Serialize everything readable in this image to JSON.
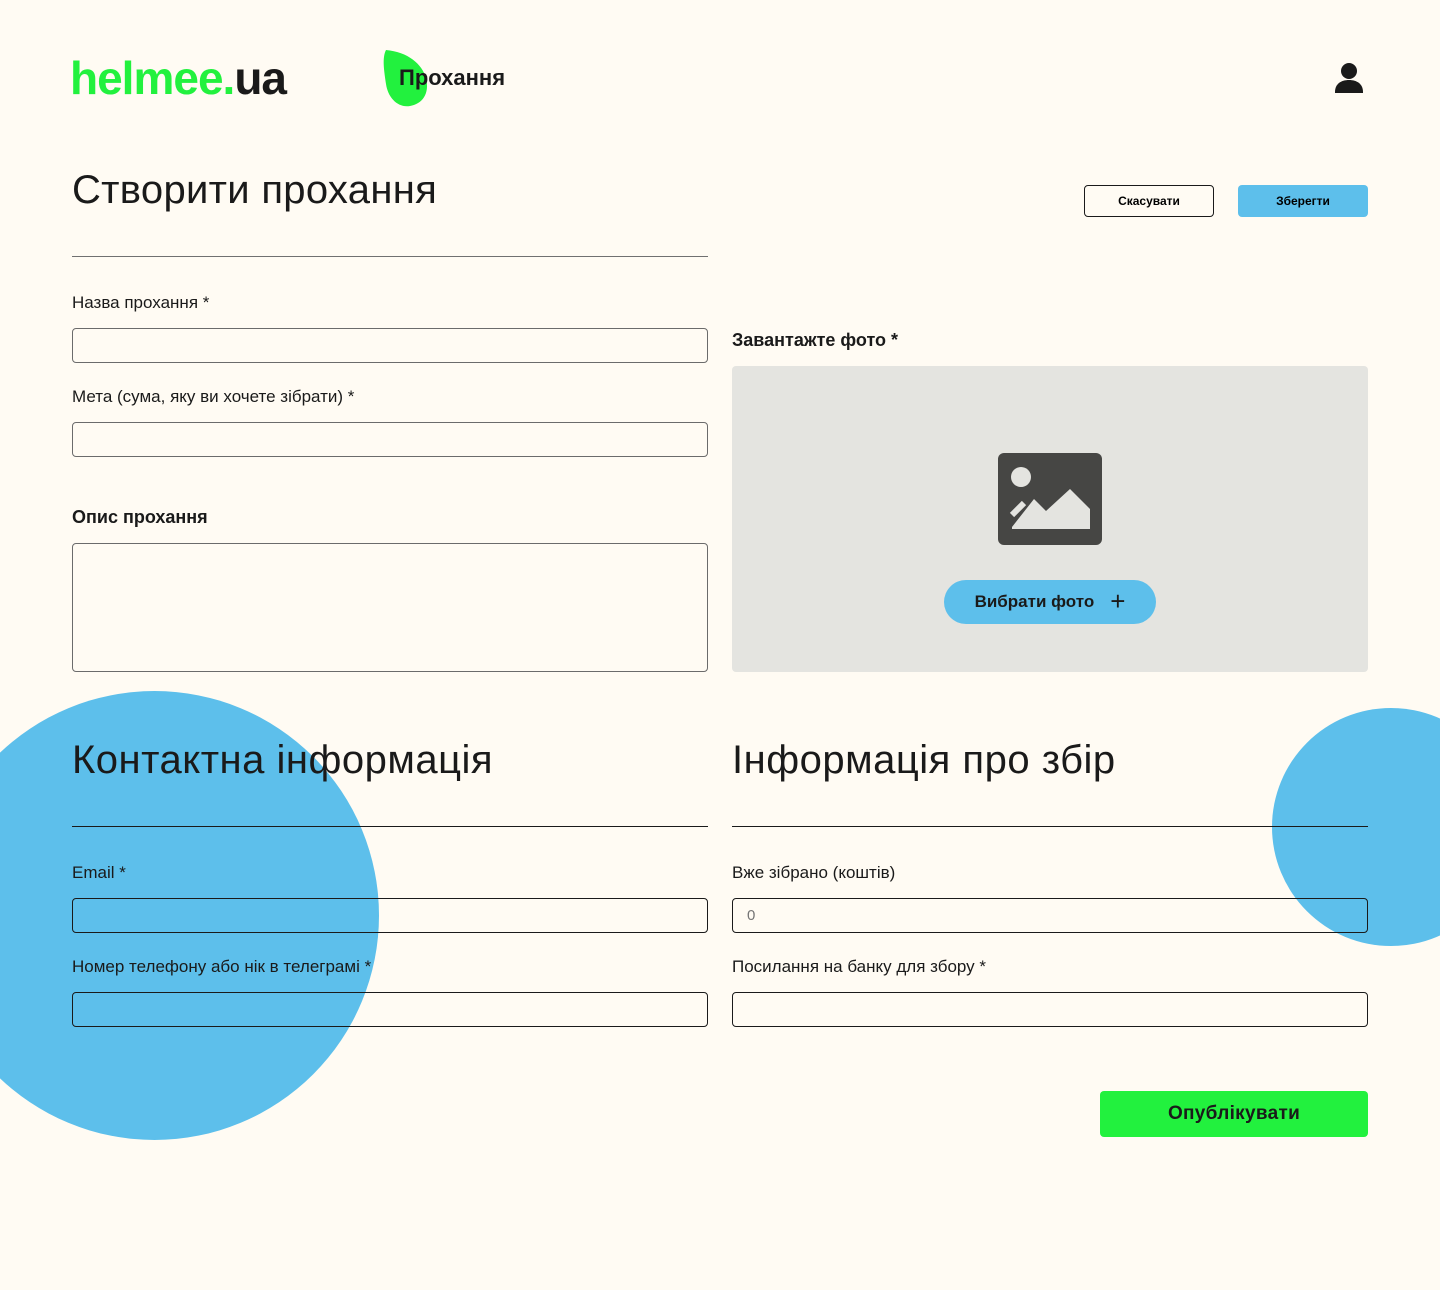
{
  "header": {
    "logo_main": "helmee.",
    "logo_tld": "ua",
    "nav_title": "Прохання"
  },
  "page": {
    "title": "Створити прохання",
    "cancel_label": "Скасувати",
    "save_label": "Зберегти"
  },
  "request_form": {
    "name_label": "Назва прохання *",
    "name_value": "",
    "goal_label": "Мета (сума, яку ви хочете зібрати) *",
    "goal_value": "",
    "description_label": "Опис прохання",
    "description_value": ""
  },
  "photo": {
    "label": "Завантажте фото *",
    "choose_label": "Вибрати фото",
    "choose_icon": "plus-icon",
    "placeholder_icon": "image-icon"
  },
  "contact": {
    "title": "Контактна інформація",
    "email_label": "Email *",
    "email_value": "",
    "phone_label": "Номер телефону або нік в телеграмі *",
    "phone_value": ""
  },
  "fundraising": {
    "title": "Інформація про збір",
    "collected_label": "Вже зібрано (коштів)",
    "collected_placeholder": "0",
    "jar_label": "Посилання на банку для збору *",
    "jar_value": ""
  },
  "publish_label": "Опублікувати",
  "colors": {
    "background": "#fffbf3",
    "brand_green": "#22f13e",
    "accent_blue": "#5dbfeb",
    "text": "#1a1a1a",
    "panel_grey": "#e4e4e0"
  }
}
